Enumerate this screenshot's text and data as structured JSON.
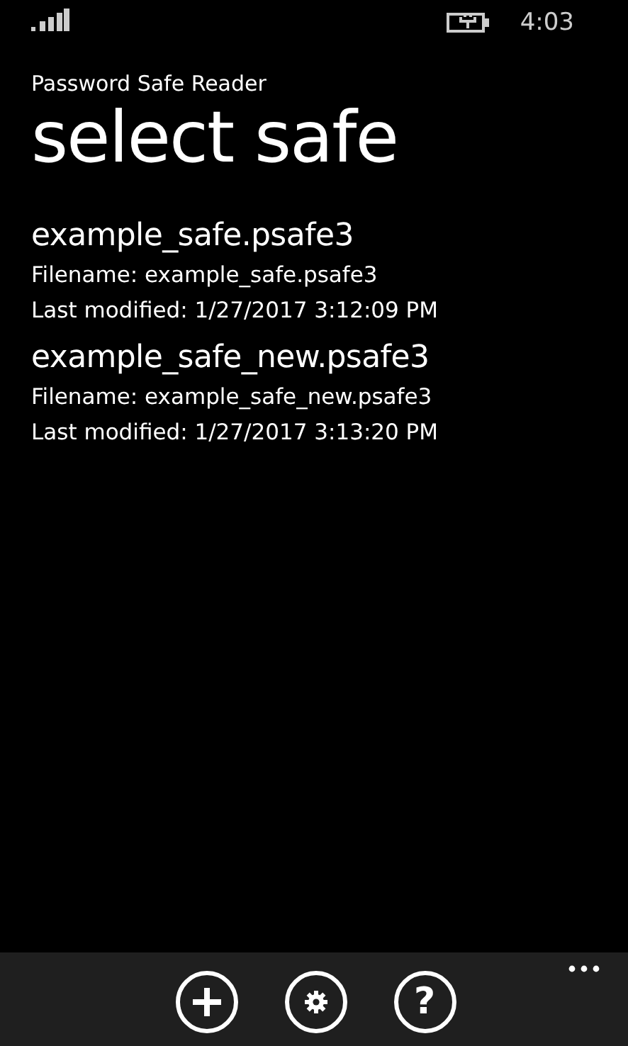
{
  "status_bar": {
    "time": "4:03"
  },
  "app": {
    "title": "Password Safe Reader",
    "page_title": "select safe"
  },
  "safes": [
    {
      "name": "example_safe.psafe3",
      "filename": "Filename: example_safe.psafe3",
      "modified": "Last modified: 1/27/2017 3:12:09 PM"
    },
    {
      "name": "example_safe_new.psafe3",
      "filename": "Filename: example_safe_new.psafe3",
      "modified": "Last modified: 1/27/2017 3:13:20 PM"
    }
  ],
  "app_bar": {
    "buttons": [
      {
        "kind": "add"
      },
      {
        "kind": "settings"
      },
      {
        "kind": "help",
        "label": "?"
      }
    ]
  }
}
